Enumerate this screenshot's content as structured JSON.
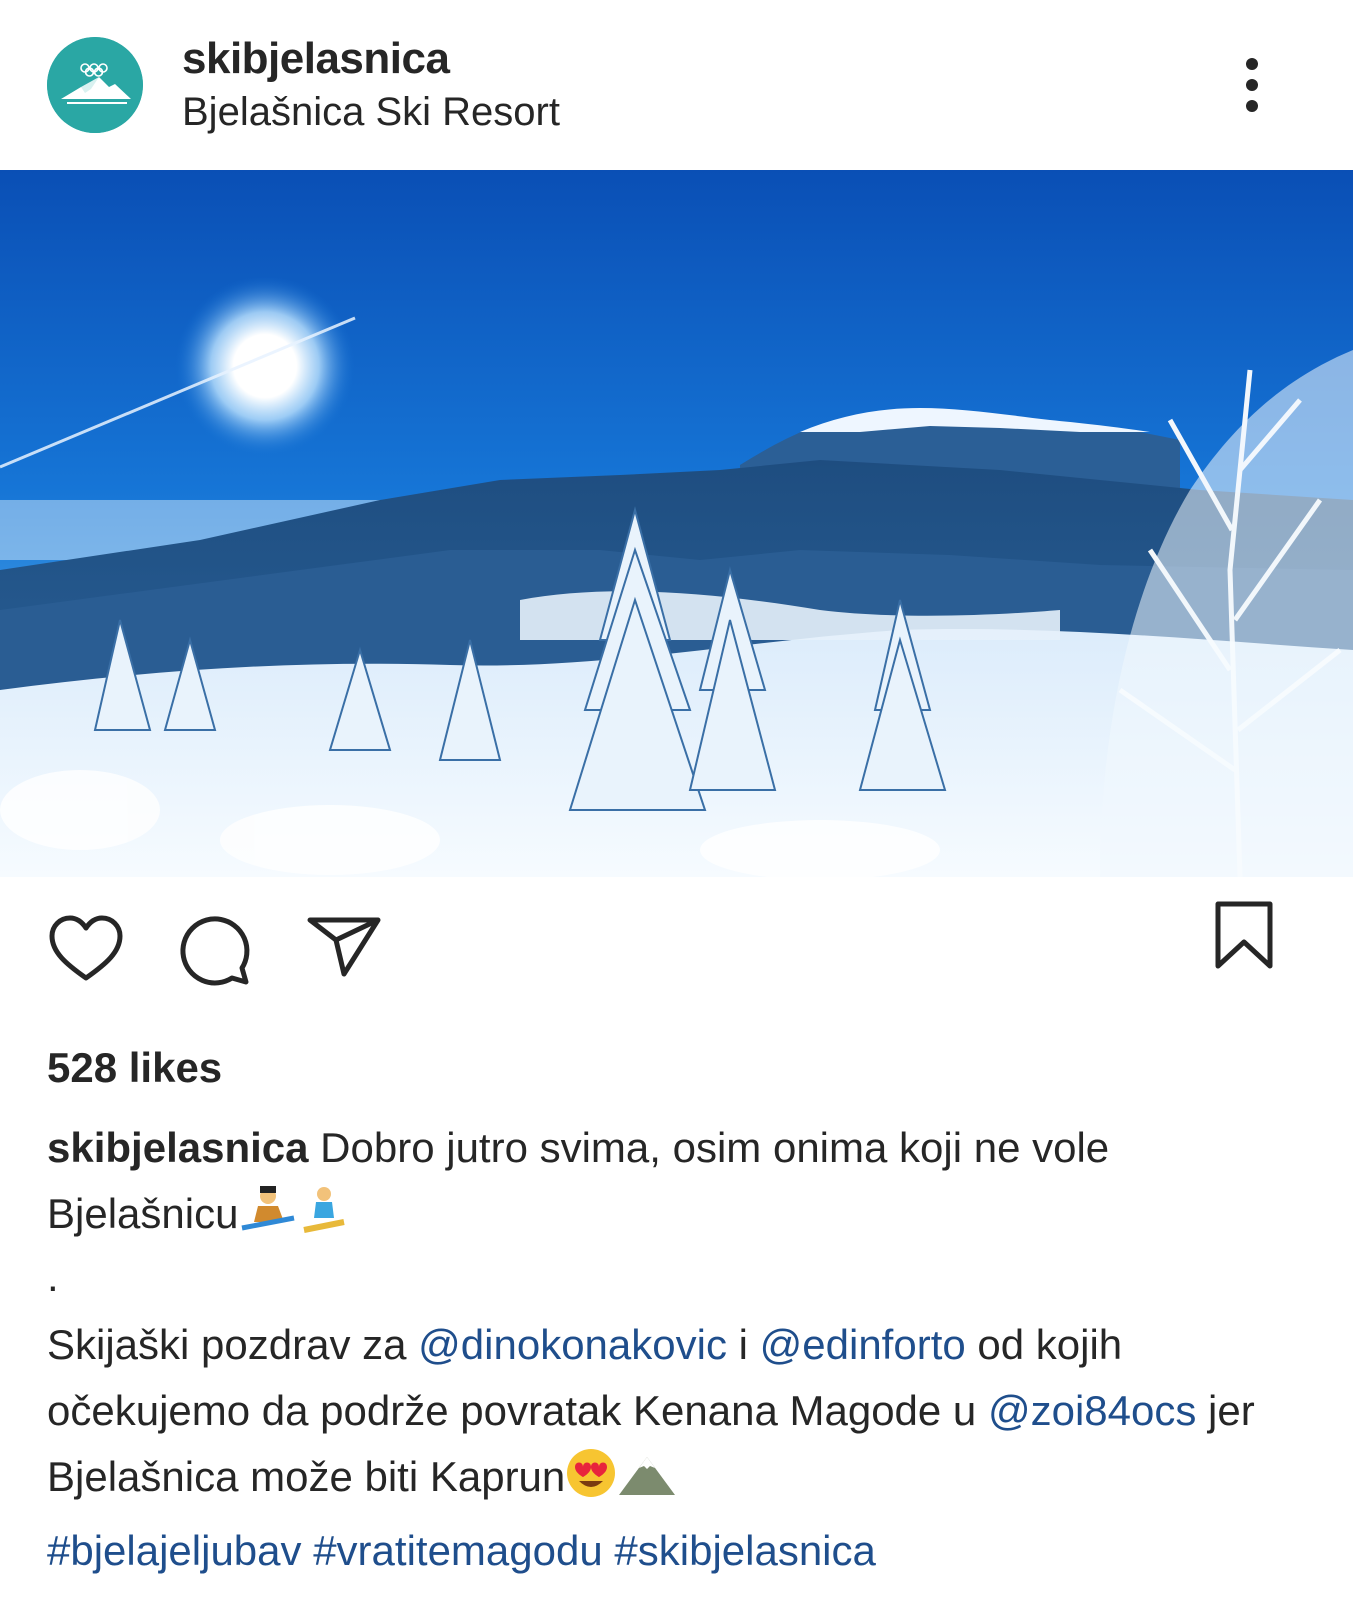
{
  "post": {
    "username": "skibjelasnica",
    "location": "Bjelašnica Ski Resort",
    "likes": "528 likes",
    "caption": {
      "username": "skibjelasnica",
      "text_line1": "Dobro jutro svima, osim onima koji ne vole",
      "text_line2": "Bjelašnicu",
      "dot": ".",
      "p2_a": "Skijaški pozdrav za ",
      "mention1": "@dinokonakovic",
      "p2_b": " i ",
      "mention2": "@edinforto",
      "p2_c": " od kojih očekujemo da podrže povratak Kenana Magode u ",
      "mention3": "@zoi84ocs",
      "p2_d": " jer Bjelašnica može biti Kaprun",
      "hashtag1": "#bjelajeljubav",
      "hashtag2": "#vratitemagodu",
      "hashtag3": "#skibjelasnica"
    }
  },
  "icons": {
    "more": "more-options-icon",
    "like": "heart-icon",
    "comment": "comment-icon",
    "share": "send-icon",
    "save": "bookmark-icon",
    "emoji1": "skier-emoji",
    "emoji2": "snowboarder-emoji",
    "emoji3": "heart-eyes-emoji",
    "emoji4": "mountain-emoji"
  },
  "colors": {
    "text": "#262626",
    "link": "#1f4e8c",
    "avatar_bg": "#2aa7a4",
    "sky": "#1366c9"
  }
}
